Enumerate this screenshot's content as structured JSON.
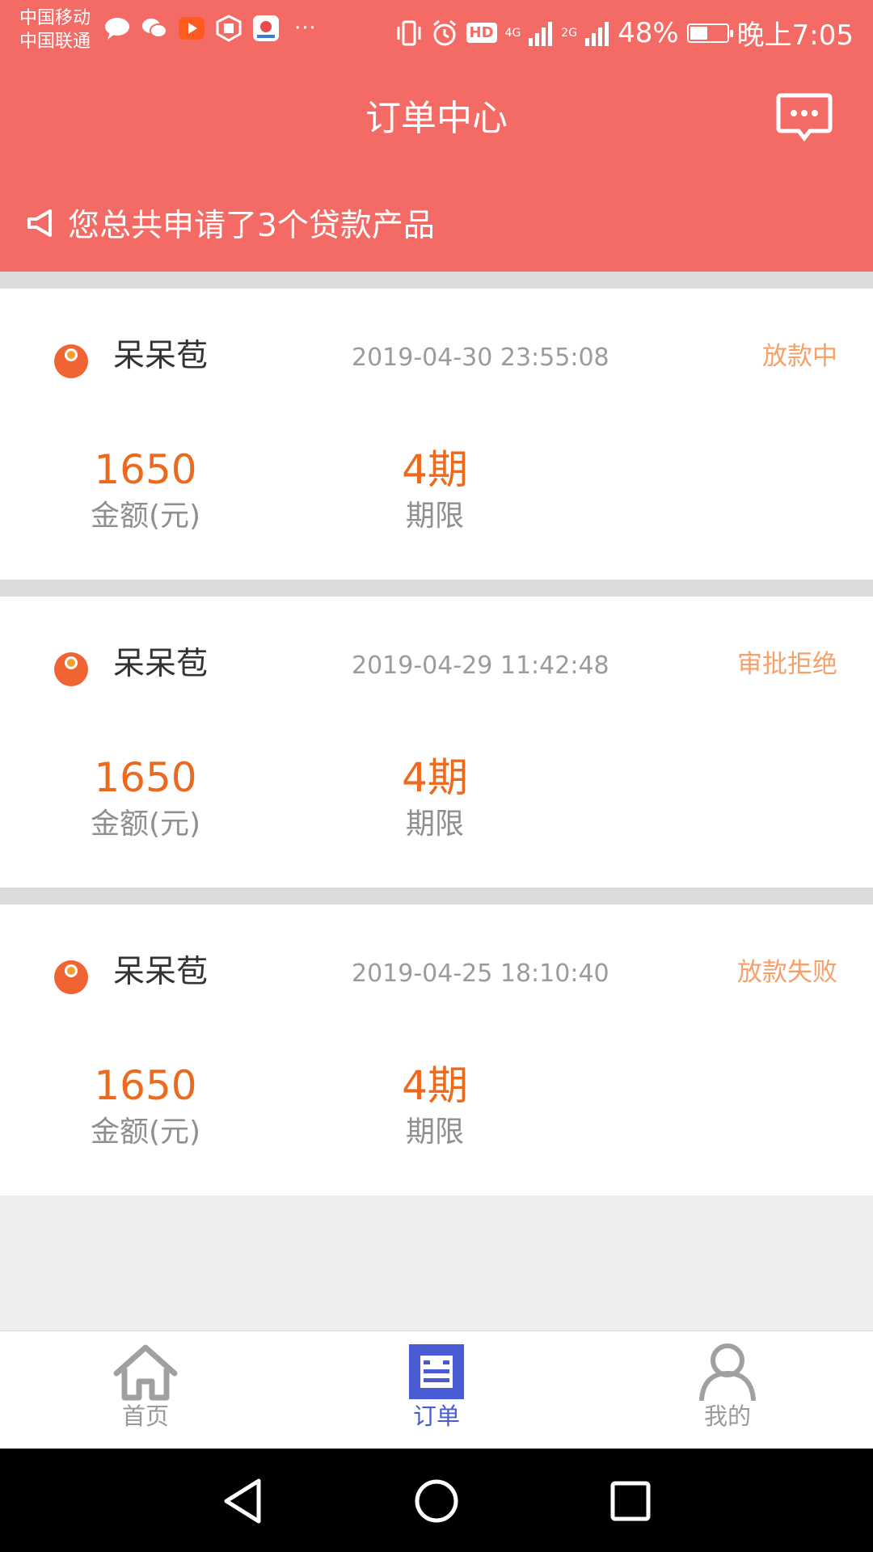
{
  "status_bar": {
    "carrier_1": "中国移动",
    "carrier_2": "中国联通",
    "app_icons": [
      "chat-bubble-icon",
      "wechat-icon",
      "video-app-icon",
      "shield-app-icon",
      "map-app-icon"
    ],
    "more": "···",
    "network_1": "4G",
    "network_2": "2G",
    "hd_badge": "HD",
    "battery_text": "48%",
    "battery_level": 0.48,
    "time": "晚上7:05"
  },
  "header": {
    "title": "订单中心",
    "message_icon": "message-icon",
    "notice_text": "您总共申请了3个贷款产品",
    "notice_icon": "megaphone-icon"
  },
  "orders": [
    {
      "name": "呆呆苞",
      "time": "2019-04-30 23:55:08",
      "status": "放款中",
      "amount": "1650",
      "amount_label": "金额(元)",
      "period": "4期",
      "period_label": "期限"
    },
    {
      "name": "呆呆苞",
      "time": "2019-04-29 11:42:48",
      "status": "审批拒绝",
      "amount": "1650",
      "amount_label": "金额(元)",
      "period": "4期",
      "period_label": "期限"
    },
    {
      "name": "呆呆苞",
      "time": "2019-04-25 18:10:40",
      "status": "放款失败",
      "amount": "1650",
      "amount_label": "金额(元)",
      "period": "4期",
      "period_label": "期限"
    }
  ],
  "tab_bar": {
    "tabs": [
      {
        "label": "首页",
        "icon": "home-icon",
        "active": false
      },
      {
        "label": "订单",
        "icon": "order-list-icon",
        "active": true
      },
      {
        "label": "我的",
        "icon": "profile-icon",
        "active": false
      }
    ]
  },
  "colors": {
    "header_bg": "#f46a64",
    "accent_orange": "#ec6a1e",
    "status_text": "#f6a06a",
    "active_tab": "#4a5bd6",
    "inactive_tab": "#9a9a9a"
  }
}
